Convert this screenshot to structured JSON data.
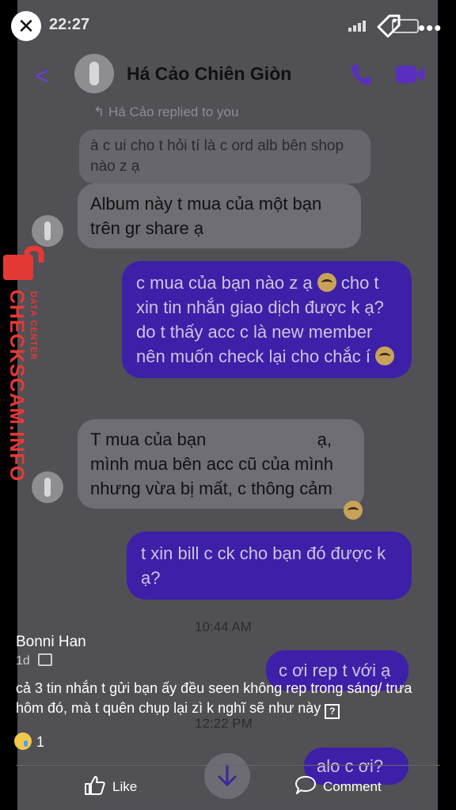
{
  "status_bar": {
    "time": "22:27"
  },
  "chat": {
    "contact_name": "Há Cảo Chiên Giòn",
    "replied_note": "Há Cảo replied to you",
    "quoted_message": "à c ui cho t hỏi tí là c ord alb bên shop nào z ạ",
    "messages": [
      {
        "side": "in",
        "text": "Album này t mua của một bạn trên gr share ạ"
      },
      {
        "side": "out",
        "line1": "c mua của bạn nào z ạ",
        "line2": "cho t xin tin nhắn giao dịch được k ạ? do t thấy acc c là new member nên muốn check lại cho chắc í"
      },
      {
        "side": "in",
        "line1": "T mua của bạn",
        "line1_end": "ạ,",
        "line2": "mình mua bên acc cũ của mình nhưng vừa bị mất, c thông cảm"
      },
      {
        "side": "out",
        "text": "t xin bill c ck cho bạn đó được k ạ?"
      },
      {
        "side": "out",
        "text": "c ơi rep t với ạ"
      },
      {
        "side": "out",
        "text": "alo c ơi?"
      }
    ],
    "time_1": "10:44 AM",
    "time_2": "12:22 PM"
  },
  "watermark": {
    "brand": "CHECKSCAM.INFO",
    "sub": "DATA CENTER"
  },
  "post": {
    "author": "Bonni Han",
    "age": "1d",
    "caption": "cả 3 tin nhắn t gửi bạn ấy đều seen không rep trong sáng/ trưa hôm đó, mà t quên chụp lại zì k nghĩ sẽ như này",
    "caption_end_glyph": "?",
    "reaction_count": "1",
    "like_label": "Like",
    "comment_label": "Comment"
  },
  "colors": {
    "accent_purple": "#6a3fcf",
    "out_bubble": "#3e1fa8",
    "stamp_red": "#e53935"
  },
  "icons": [
    "close-icon",
    "tag-icon",
    "more-icon",
    "back-icon",
    "phone-icon",
    "video-icon",
    "like-icon",
    "comment-icon",
    "scroll-down-icon"
  ]
}
